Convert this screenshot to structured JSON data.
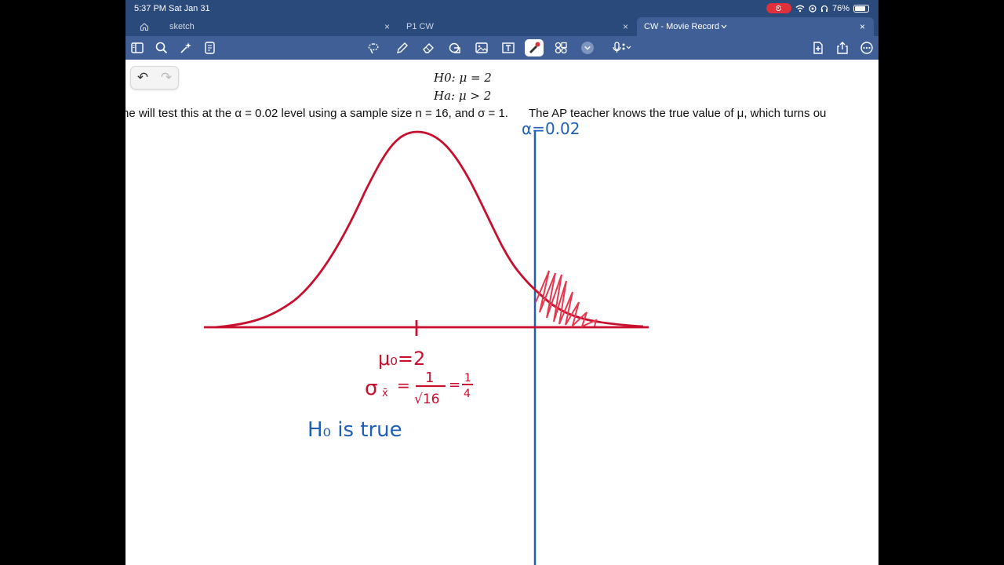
{
  "status_bar": {
    "time": "5:37 PM",
    "date": "Sat Jan 31",
    "battery": "76%",
    "icons": [
      "screen-record-icon",
      "wifi-icon",
      "location-icon",
      "headphones-icon",
      "battery-icon"
    ]
  },
  "tabs": [
    {
      "label": "sketch",
      "active": false
    },
    {
      "label": "P1 CW",
      "active": false
    },
    {
      "label": "CW - Movie Record",
      "active": true
    }
  ],
  "toolbar": {
    "icons": [
      "sidebar-icon",
      "search-icon",
      "sparkle-icon",
      "document-icon",
      "lasso-icon",
      "pen-icon",
      "eraser-icon",
      "shapes-icon",
      "image-icon",
      "text-box-icon",
      "laser-pointer-icon",
      "elements-icon",
      "chevron-down-icon",
      "microphone-icon",
      "add-page-icon",
      "share-icon",
      "more-icon"
    ],
    "colors": {
      "bar": "#3f5f96",
      "status": "#2b4a7c"
    }
  },
  "undo": {
    "undo_glyph": "↶",
    "redo_glyph": "↷"
  },
  "hypotheses": {
    "null": "H0: μ = 2",
    "alt": "Ha: μ > 2"
  },
  "problem_text": {
    "part1": "he will test this at the α = 0.02 level using a sample size n = 16, and σ = 1.",
    "part2": "The AP teacher knows the true value of μ, which turns ou"
  },
  "annotations": {
    "alpha": "α=0.02",
    "mu0": "μ₀=2",
    "sigma_label": "σ",
    "sigma_sub": "x̄",
    "sigma_eq": "=",
    "frac_num": "1",
    "frac_den": "√16",
    "quarter_num": "1",
    "quarter_den": "4",
    "h0_true": "H₀ is true"
  },
  "ink_colors": {
    "red": "#c8102e",
    "blue": "#1f5fb8"
  }
}
